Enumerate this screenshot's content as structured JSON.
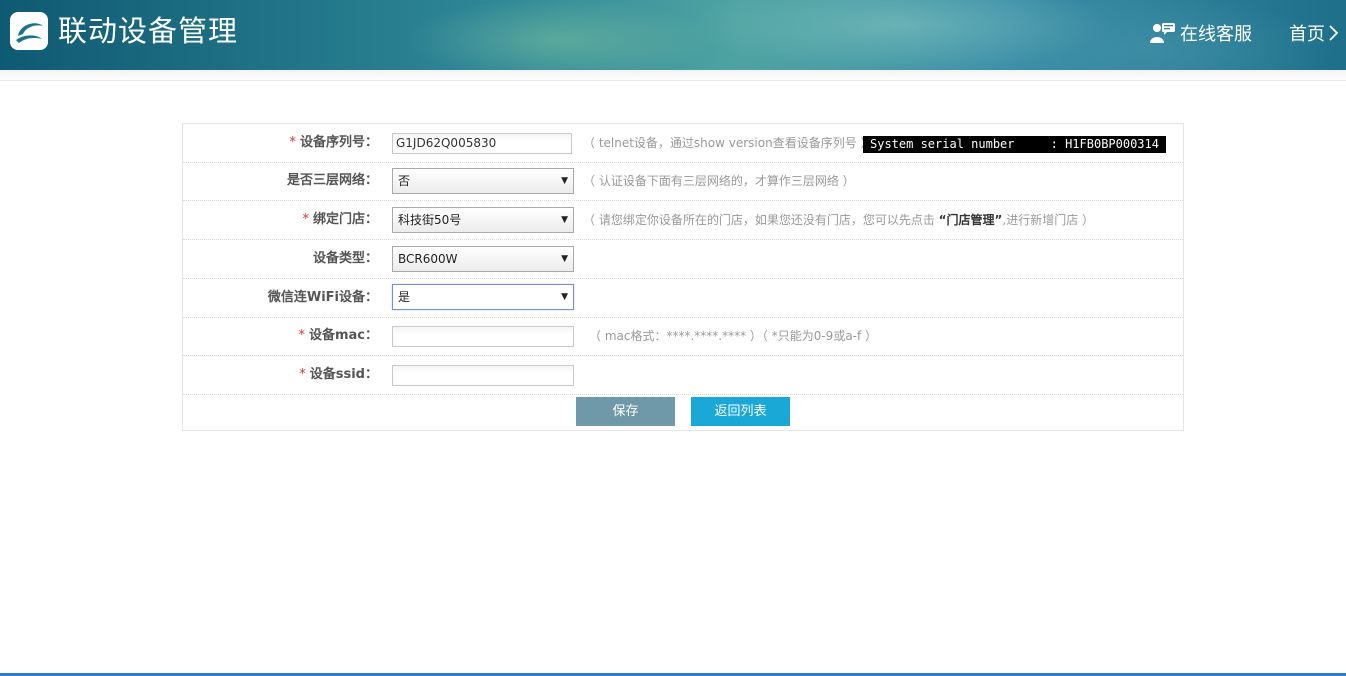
{
  "header": {
    "title": "联动设备管理",
    "customer_service": "在线客服",
    "home": "首页",
    "logo_icon": "logo-icon",
    "cs_icon": "customer-service-icon",
    "home_icon": "chevron-right-icon"
  },
  "form": {
    "serial": {
      "label": "设备序列号：",
      "required_mark": "*",
      "value": "G1JD62Q005830",
      "hint": "（ telnet设备，通过show version查看设备序列号 ）",
      "sample_output": "System serial number     : H1FB0BP000314"
    },
    "layer3": {
      "label": "是否三层网络：",
      "selected": "否",
      "hint": "（ 认证设备下面有三层网络的，才算作三层网络 ）"
    },
    "store": {
      "label": "绑定门店：",
      "required_mark": "*",
      "selected": "科技街50号",
      "hint_before": "（ 请您绑定你设备所在的门店，如果您还没有门店，您可以先点击 ",
      "hint_link": "“门店管理”",
      "hint_after": ",进行新增门店 ）"
    },
    "device_type": {
      "label": "设备类型：",
      "selected": "BCR600W"
    },
    "wechat_wifi": {
      "label": "微信连WiFi设备：",
      "selected": "是"
    },
    "mac": {
      "label": "设备mac：",
      "required_mark": "*",
      "value": "",
      "hint": "（ mac格式：****.****.**** ）（ *只能为0-9或a-f ）"
    },
    "ssid": {
      "label": "设备ssid：",
      "required_mark": "*",
      "value": ""
    },
    "buttons": {
      "save": "保存",
      "back": "返回列表"
    }
  },
  "colors": {
    "required": "#e0312b",
    "save_button": "#6f99a8",
    "back_button": "#1aa8d6"
  }
}
